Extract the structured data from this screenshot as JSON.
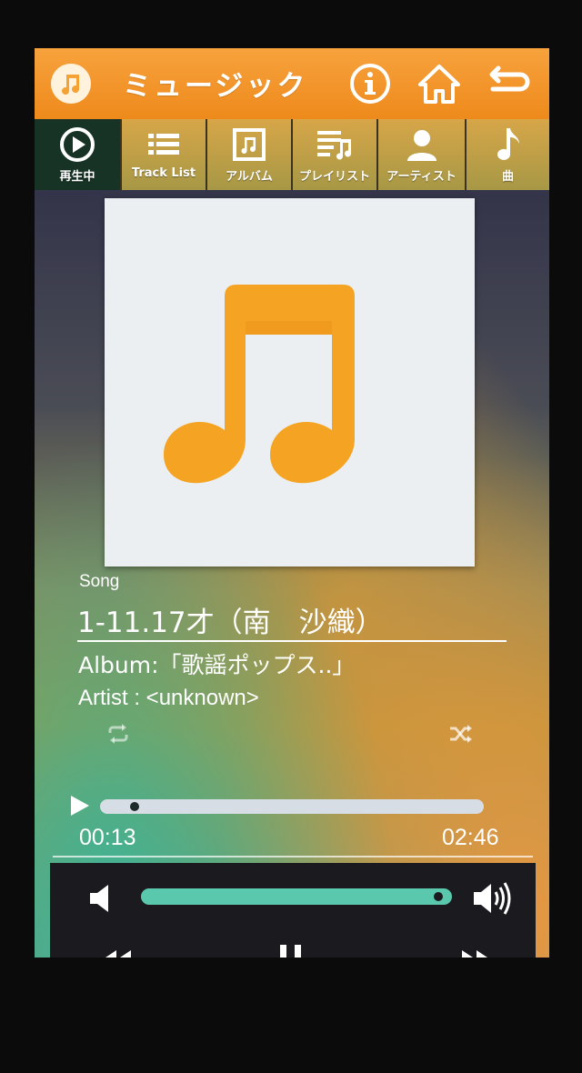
{
  "header": {
    "app_title": "ミュージック",
    "app_icon": "music-note-icon",
    "info_icon": "info-icon",
    "home_icon": "home-icon",
    "back_icon": "back-arrow-icon"
  },
  "tabs": [
    {
      "label": "再生中",
      "icon": "play-circle-icon",
      "active": true
    },
    {
      "label": "Track List",
      "icon": "list-icon",
      "active": false
    },
    {
      "label": "アルバム",
      "icon": "album-icon",
      "active": false
    },
    {
      "label": "プレイリスト",
      "icon": "playlist-icon",
      "active": false
    },
    {
      "label": "アーティスト",
      "icon": "person-icon",
      "active": false
    },
    {
      "label": "曲",
      "icon": "music-note-icon",
      "active": false
    }
  ],
  "now_playing": {
    "song_label": "Song",
    "title": "1-11.17才（南　沙織）",
    "album": "Album:「歌謡ポップス..」",
    "artist": "Artist : <unknown>",
    "current_time": "00:13",
    "total_time": "02:46",
    "progress_fraction": 0.08
  },
  "volume": {
    "level_fraction": 0.97
  },
  "colors": {
    "accent_orange": "#ee8a1c",
    "active_tab": "#173326",
    "volume_teal": "#59c8ad",
    "note_orange": "#f5a323"
  }
}
